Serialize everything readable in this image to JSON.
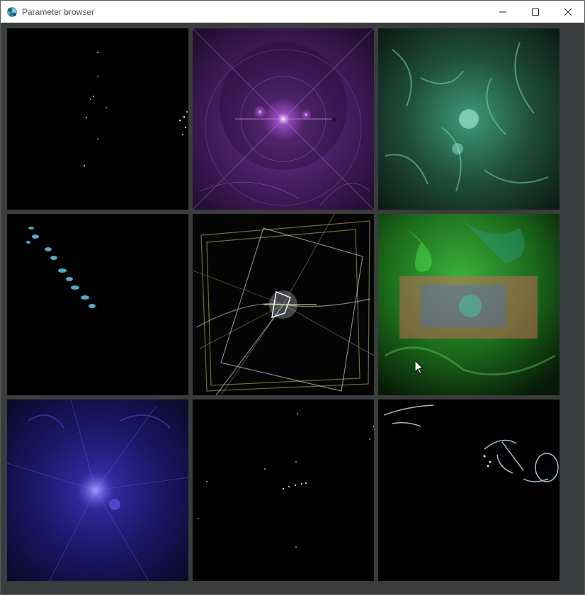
{
  "window": {
    "title": "Parameter browser",
    "icon": "fractal-app-icon",
    "controls": [
      "minimize-icon",
      "maximize-icon",
      "close-icon"
    ]
  },
  "grid": {
    "rows": 3,
    "columns": 3,
    "thumbnails": [
      {
        "name": "preview-1",
        "description_color": "#000000"
      },
      {
        "name": "preview-2",
        "description_color": "#6a2c86"
      },
      {
        "name": "preview-3",
        "description_color": "#2f7a5c"
      },
      {
        "name": "preview-4",
        "description_color": "#000000"
      },
      {
        "name": "preview-5",
        "description_color": "#4a4a2a"
      },
      {
        "name": "preview-6",
        "description_color": "#1c6b1c"
      },
      {
        "name": "preview-7",
        "description_color": "#1e1a6e"
      },
      {
        "name": "preview-8",
        "description_color": "#000000"
      },
      {
        "name": "preview-9",
        "description_color": "#000000"
      }
    ]
  },
  "colors": {
    "background": "#3b3c3e",
    "titlebar": "#ffffff"
  }
}
